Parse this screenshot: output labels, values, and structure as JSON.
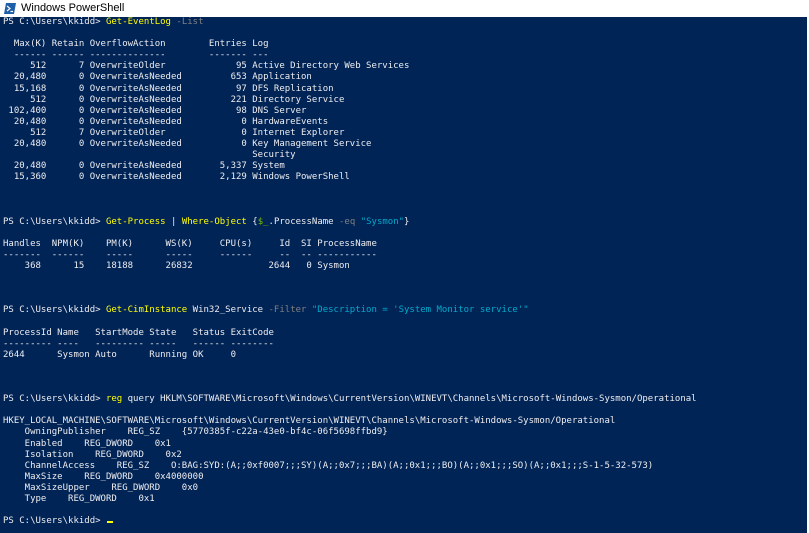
{
  "window": {
    "title": "Windows PowerShell",
    "colors": {
      "background": "#012456",
      "text": "#eeedf0",
      "command": "#ffff00",
      "parameter": "#808080",
      "string": "#00abcd",
      "variable": "#76b900"
    }
  },
  "console": {
    "lines": [
      [
        {
          "t": "PS C:\\Users\\kkidd> "
        },
        {
          "t": "Get-EventLog",
          "c": "cmd"
        },
        {
          "t": " -List",
          "c": "par"
        }
      ],
      [
        {
          "t": ""
        }
      ],
      [
        {
          "t": "  Max(K) Retain OverflowAction        Entries Log"
        }
      ],
      [
        {
          "t": "  ------ ------ --------------        ------- ---"
        }
      ],
      [
        {
          "t": "     512      7 OverwriteOlder             95 Active Directory Web Services"
        }
      ],
      [
        {
          "t": "  20,480      0 OverwriteAsNeeded         653 Application"
        }
      ],
      [
        {
          "t": "  15,168      0 OverwriteAsNeeded          97 DFS Replication"
        }
      ],
      [
        {
          "t": "     512      0 OverwriteAsNeeded         221 Directory Service"
        }
      ],
      [
        {
          "t": " 102,400      0 OverwriteAsNeeded          98 DNS Server"
        }
      ],
      [
        {
          "t": "  20,480      0 OverwriteAsNeeded           0 HardwareEvents"
        }
      ],
      [
        {
          "t": "     512      7 OverwriteOlder              0 Internet Explorer"
        }
      ],
      [
        {
          "t": "  20,480      0 OverwriteAsNeeded           0 Key Management Service"
        }
      ],
      [
        {
          "t": "                                              Security"
        }
      ],
      [
        {
          "t": "  20,480      0 OverwriteAsNeeded       5,337 System"
        }
      ],
      [
        {
          "t": "  15,360      0 OverwriteAsNeeded       2,129 Windows PowerShell"
        }
      ],
      [
        {
          "t": ""
        }
      ],
      [
        {
          "t": ""
        }
      ],
      [
        {
          "t": ""
        }
      ],
      [
        {
          "t": "PS C:\\Users\\kkidd> "
        },
        {
          "t": "Get-Process",
          "c": "cmd"
        },
        {
          "t": " | "
        },
        {
          "t": "Where-Object",
          "c": "cmd"
        },
        {
          "t": " {"
        },
        {
          "t": "$_",
          "c": "var"
        },
        {
          "t": ".ProcessName "
        },
        {
          "t": "-eq",
          "c": "par"
        },
        {
          "t": " "
        },
        {
          "t": "\"Sysmon\"",
          "c": "str"
        },
        {
          "t": "}"
        }
      ],
      [
        {
          "t": ""
        }
      ],
      [
        {
          "t": "Handles  NPM(K)    PM(K)      WS(K)     CPU(s)     Id  SI ProcessName"
        }
      ],
      [
        {
          "t": "-------  ------    -----      -----     ------     --  -- -----------"
        }
      ],
      [
        {
          "t": "    368      15    18188      26832              2644   0 Sysmon"
        }
      ],
      [
        {
          "t": ""
        }
      ],
      [
        {
          "t": ""
        }
      ],
      [
        {
          "t": ""
        }
      ],
      [
        {
          "t": "PS C:\\Users\\kkidd> "
        },
        {
          "t": "Get-CimInstance",
          "c": "cmd"
        },
        {
          "t": " Win32_Service "
        },
        {
          "t": "-Filter",
          "c": "par"
        },
        {
          "t": " "
        },
        {
          "t": "\"Description = 'System Monitor service'\"",
          "c": "str"
        }
      ],
      [
        {
          "t": ""
        }
      ],
      [
        {
          "t": "ProcessId Name   StartMode State   Status ExitCode"
        }
      ],
      [
        {
          "t": "--------- ----   --------- -----   ------ --------"
        }
      ],
      [
        {
          "t": "2644      Sysmon Auto      Running OK     0"
        }
      ],
      [
        {
          "t": ""
        }
      ],
      [
        {
          "t": ""
        }
      ],
      [
        {
          "t": ""
        }
      ],
      [
        {
          "t": "PS C:\\Users\\kkidd> "
        },
        {
          "t": "reg",
          "c": "cmd"
        },
        {
          "t": " query HKLM\\SOFTWARE\\Microsoft\\Windows\\CurrentVersion\\WINEVT\\Channels\\Microsoft-Windows-Sysmon/Operational"
        }
      ],
      [
        {
          "t": ""
        }
      ],
      [
        {
          "t": "HKEY_LOCAL_MACHINE\\SOFTWARE\\Microsoft\\Windows\\CurrentVersion\\WINEVT\\Channels\\Microsoft-Windows-Sysmon/Operational"
        }
      ],
      [
        {
          "t": "    OwningPublisher    REG_SZ    {5770385f-c22a-43e0-bf4c-06f5698ffbd9}"
        }
      ],
      [
        {
          "t": "    Enabled    REG_DWORD    0x1"
        }
      ],
      [
        {
          "t": "    Isolation    REG_DWORD    0x2"
        }
      ],
      [
        {
          "t": "    ChannelAccess    REG_SZ    O:BAG:SYD:(A;;0xf0007;;;SY)(A;;0x7;;;BA)(A;;0x1;;;BO)(A;;0x1;;;SO)(A;;0x1;;;S-1-5-32-573)"
        }
      ],
      [
        {
          "t": "    MaxSize    REG_DWORD    0x4000000"
        }
      ],
      [
        {
          "t": "    MaxSizeUpper    REG_DWORD    0x0"
        }
      ],
      [
        {
          "t": "    Type    REG_DWORD    0x1"
        }
      ],
      [
        {
          "t": ""
        }
      ],
      [
        {
          "t": "PS C:\\Users\\kkidd> "
        }
      ]
    ]
  }
}
